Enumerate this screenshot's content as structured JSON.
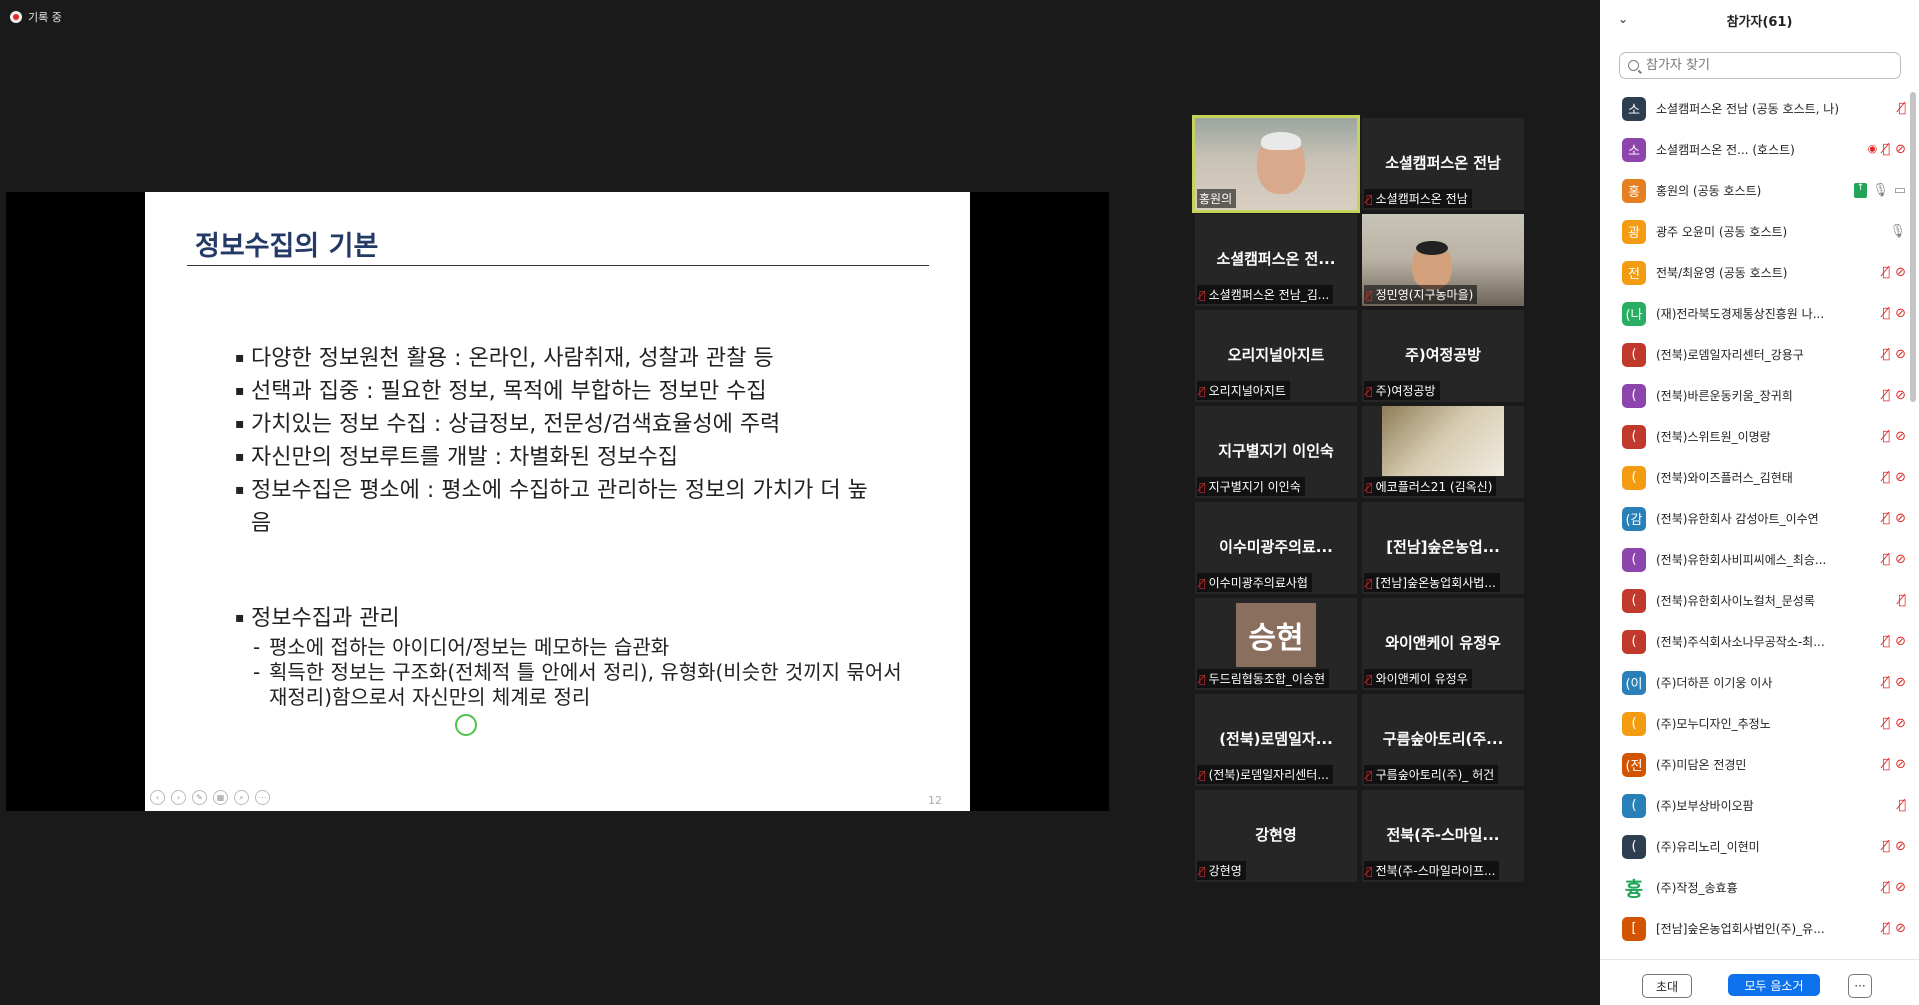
{
  "recording": {
    "label": "기록 중"
  },
  "slide": {
    "title": "정보수집의 기본",
    "bullets": [
      "다양한 정보원천 활용 : 온라인, 사람취재, 성찰과 관찰 등",
      "선택과 집중 : 필요한 정보, 목적에 부합하는 정보만 수집",
      "가치있는 정보 수집 : 상급정보, 전문성/검색효율성에 주력",
      "자신만의 정보루트를 개발 : 차별화된 정보수집",
      "정보수집은 평소에 : 평소에 수집하고 관리하는 정보의 가치가 더 높음"
    ],
    "bullet2": "정보수집과 관리",
    "subs": [
      "평소에 접하는 아이디어/정보는 메모하는 습관화",
      "획득한 정보는 구조화(전체적 틀 안에서 정리), 유형화(비슷한 것끼지 묶어서 재정리)함으로서 자신만의 체계로 정리"
    ],
    "page_number": "12"
  },
  "tiles": [
    {
      "big": "",
      "label": "홍원의",
      "muted": false
    },
    {
      "big": "소셜캠퍼스온 전남",
      "label": "소셜캠퍼스온 전남",
      "muted": true
    },
    {
      "big": "소셜캠퍼스온 전...",
      "label": "소셜캠퍼스온 전남_김...",
      "muted": true
    },
    {
      "big": "",
      "label": "정민영(지구농마을)",
      "muted": true
    },
    {
      "big": "오리지널아지트",
      "label": "오리지널아지트",
      "muted": true
    },
    {
      "big": "주)여정공방",
      "label": "주)여정공방",
      "muted": true
    },
    {
      "big": "지구별지기 이인숙",
      "label": "지구별지기 이인숙",
      "muted": true
    },
    {
      "big": "",
      "label": "에코플러스21 (김옥신)",
      "muted": true
    },
    {
      "big": "이수미광주의료...",
      "label": "이수미광주의료사협",
      "muted": true
    },
    {
      "big": "[전남]숲온농업...",
      "label": "[전남]숲온농업회사법...",
      "muted": true
    },
    {
      "big": "승현",
      "label": "두드림협동조합_이승현",
      "muted": true
    },
    {
      "big": "와이앤케이 유정우",
      "label": "와이앤케이 유정우",
      "muted": true
    },
    {
      "big": "(전북)로뎀일자...",
      "label": "(전북)로뎀일자리센터...",
      "muted": true
    },
    {
      "big": "구름숲아토리(주...",
      "label": "구름숲아토리(주)_ 허건",
      "muted": true
    },
    {
      "big": "강현영",
      "label": "강현영",
      "muted": true
    },
    {
      "big": "전북(주-스마일...",
      "label": "전북(주-스마일라이프...",
      "muted": true
    }
  ],
  "panel": {
    "title": "참가자(61)",
    "search_placeholder": "참가자 찾기",
    "participants": [
      {
        "initial": "소",
        "color": "#2d3e50",
        "name": "소셜캠퍼스온 전남 (공동 호스트, 나)",
        "icons": [
          "mic-off"
        ]
      },
      {
        "initial": "소",
        "color": "#8e44ad",
        "name": "소셜캠퍼스온 전...  (호스트)",
        "icons": [
          "rec",
          "mic-off",
          "video-off"
        ]
      },
      {
        "initial": "홍",
        "color": "#e67e22",
        "name": "홍원의 (공동 호스트)",
        "icons": [
          "share",
          "mic-on",
          "video-on"
        ]
      },
      {
        "initial": "광",
        "color": "#f39c12",
        "name": "광주 오윤미 (공동 호스트)",
        "icons": [
          "mic-on"
        ]
      },
      {
        "initial": "전",
        "color": "#f39c12",
        "name": "전북/최윤영 (공동 호스트)",
        "icons": [
          "mic-off",
          "video-off"
        ]
      },
      {
        "initial": "(나",
        "color": "#27ae60",
        "name": "(재)전라북도경제통상진흥원 나...",
        "icons": [
          "mic-off",
          "video-off"
        ]
      },
      {
        "initial": "(",
        "color": "#c0392b",
        "name": "(전북)로뎀일자리센터_강용구",
        "icons": [
          "mic-off",
          "video-off"
        ]
      },
      {
        "initial": "(",
        "color": "#8e44ad",
        "name": "(전북)바른운동키움_장귀희",
        "icons": [
          "mic-off",
          "video-off"
        ]
      },
      {
        "initial": "(",
        "color": "#c0392b",
        "name": "(전북)스위트원_이명랑",
        "icons": [
          "mic-off",
          "video-off"
        ]
      },
      {
        "initial": "(",
        "color": "#f39c12",
        "name": "(전북)와이즈플러스_김현태",
        "icons": [
          "mic-off",
          "video-off"
        ]
      },
      {
        "initial": "(감",
        "color": "#2980b9",
        "name": "(전북)유한회사 감성아트_이수연",
        "icons": [
          "mic-off",
          "video-off"
        ]
      },
      {
        "initial": "(",
        "color": "#8e44ad",
        "name": "(전북)유한회사비피씨에스_최승...",
        "icons": [
          "mic-off",
          "video-off"
        ]
      },
      {
        "initial": "(",
        "color": "#c0392b",
        "name": "(전북)유한회사이노컬처_문성록",
        "icons": [
          "mic-off"
        ]
      },
      {
        "initial": "(",
        "color": "#c0392b",
        "name": "(전북)주식회사소나무공작소-최...",
        "icons": [
          "mic-off",
          "video-off"
        ]
      },
      {
        "initial": "(이",
        "color": "#2980b9",
        "name": "(주)더하픈 이기웅  이사",
        "icons": [
          "mic-off",
          "video-off"
        ]
      },
      {
        "initial": "(",
        "color": "#f39c12",
        "name": "(주)모누디자인_추정노",
        "icons": [
          "mic-off",
          "video-off"
        ]
      },
      {
        "initial": "(전",
        "color": "#d35400",
        "name": "(주)미담온 전경민",
        "icons": [
          "mic-off",
          "video-off"
        ]
      },
      {
        "initial": "(",
        "color": "#2980b9",
        "name": "(주)보부상바이오팜",
        "icons": [
          "mic-off"
        ]
      },
      {
        "initial": "(",
        "color": "#2d3e50",
        "name": "(주)유리노리_이현미",
        "icons": [
          "mic-off",
          "video-off"
        ]
      },
      {
        "initial": "흉",
        "color": "#ffffff",
        "name": "(주)작정_송효흉",
        "icons": [
          "mic-off",
          "video-off"
        ]
      },
      {
        "initial": "[",
        "color": "#d35400",
        "name": "[전남]숲온농업회사법인(주)_유...",
        "icons": [
          "mic-off",
          "video-off"
        ]
      }
    ],
    "invite_label": "초대",
    "mute_all_label": "모두 음소거",
    "more_label": "···"
  }
}
